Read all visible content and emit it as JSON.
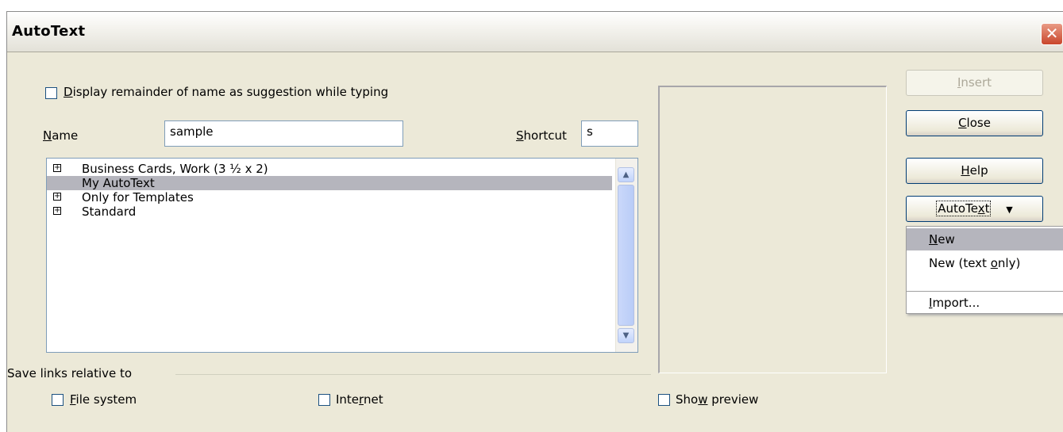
{
  "window": {
    "title": "AutoText"
  },
  "options": {
    "display_remainder": {
      "pre": "",
      "key": "D",
      "post": "isplay remainder of name as suggestion while typing"
    }
  },
  "name_field": {
    "label_key": "N",
    "label_post": "ame",
    "value": "sample"
  },
  "shortcut_field": {
    "label_key": "S",
    "label_post": "hortcut",
    "value": "s"
  },
  "tree": {
    "items": [
      {
        "label": "Business Cards, Work (3 ½ x 2)",
        "expandable": true,
        "selected": false
      },
      {
        "label": "My AutoText",
        "expandable": false,
        "selected": true
      },
      {
        "label": "Only for Templates",
        "expandable": true,
        "selected": false
      },
      {
        "label": "Standard",
        "expandable": true,
        "selected": false
      }
    ]
  },
  "save_links": {
    "label": "Save links relative to",
    "file_system": {
      "key": "F",
      "post": "ile system"
    },
    "internet": {
      "pre": "Inte",
      "key": "r",
      "post": "net"
    }
  },
  "show_preview": {
    "pre": "Sho",
    "key": "w",
    "post": " preview"
  },
  "buttons": {
    "insert": {
      "key": "I",
      "post": "nsert"
    },
    "close": {
      "key": "C",
      "post": "lose"
    },
    "help": {
      "key": "H",
      "post": "elp"
    },
    "autotext": {
      "pre": "AutoTe",
      "key": "x",
      "post": "t"
    }
  },
  "autotext_menu": {
    "new": {
      "key": "N",
      "post": "ew"
    },
    "new_text_only": {
      "pre": "New (text ",
      "key": "o",
      "post": "nly)"
    },
    "import": {
      "key": "I",
      "post": "mport..."
    }
  },
  "colors": {
    "selection": "#b5b5bd",
    "dialog_bg": "#ece9d8"
  }
}
